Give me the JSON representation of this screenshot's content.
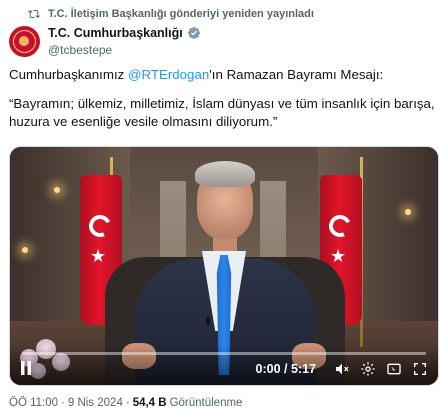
{
  "repost": {
    "icon": "repost-icon",
    "text": "T.C. İletişim Başkanlığı gönderiyi yeniden yayınladı"
  },
  "author": {
    "name": "T.C. Cumhurbaşkanlığı",
    "handle": "@tcbestepe",
    "verified_icon": "verified-badge-icon",
    "verified_color": "#829aab"
  },
  "tweet": {
    "line1_pre": "Cumhurbaşkanımız ",
    "mention": "@RTErdogan",
    "line1_post": "'ın Ramazan Bayramı Mesajı:",
    "quote": "“Bayramın; ülkemiz, milletimiz, İslam dünyası ve tüm insanlık için barışa, huzura ve esenliğe vesile olmasını diliyorum.”"
  },
  "video": {
    "time": "0:00 / 5:17",
    "progress": 0.0,
    "controls": [
      "pause-icon",
      "mute-icon",
      "settings-icon",
      "pip-icon",
      "fullscreen-icon"
    ],
    "accent": "#1d9bf0"
  },
  "meta": {
    "time": "ÖÖ 11:00",
    "sep1": "·",
    "date": "9 Nis 2024",
    "sep2": "·",
    "views": "54,4 B",
    "views_label": "Görüntülenme"
  }
}
